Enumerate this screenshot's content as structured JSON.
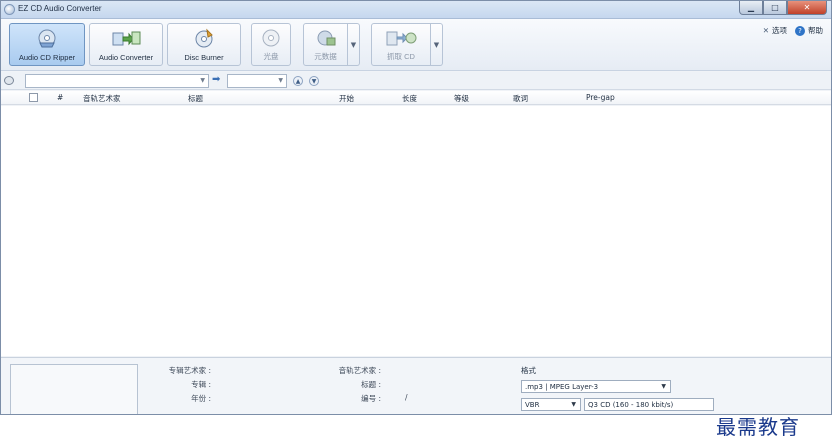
{
  "window": {
    "title": "EZ CD Audio Converter"
  },
  "ribbon": {
    "buttons": [
      {
        "label": "Audio CD Ripper",
        "icon": "cd-ripper-icon"
      },
      {
        "label": "Audio Converter",
        "icon": "audio-converter-icon"
      },
      {
        "label": "Disc Burner",
        "icon": "disc-burner-icon"
      },
      {
        "label": "光盘",
        "icon": "disc-icon"
      },
      {
        "label": "元数据",
        "icon": "metadata-icon"
      },
      {
        "label": "抓取 CD",
        "icon": "rip-cd-icon"
      }
    ],
    "options_label": "选项",
    "help_label": "帮助"
  },
  "table": {
    "columns": [
      "#",
      "音轨艺术家",
      "标题",
      "开始",
      "长度",
      "等级",
      "歌词",
      "Pre-gap"
    ]
  },
  "metadata": {
    "album_artist_label": "专辑艺术家 :",
    "album_label": "专辑 :",
    "year_label": "年份 :",
    "track_artist_label": "音轨艺术家 :",
    "title_label": "标题 :",
    "number_label": "编号 :",
    "number_value": "/"
  },
  "format": {
    "title": "格式",
    "format_value": ".mp3 | MPEG Layer-3",
    "mode_value": "VBR",
    "quality_value": "Q3  CD  (160 - 180 kbit/s)"
  },
  "watermark": "最需教育",
  "colors": {
    "accent": "#2f74c7",
    "close": "#c0412a",
    "watermark": "#1b3a8c"
  }
}
